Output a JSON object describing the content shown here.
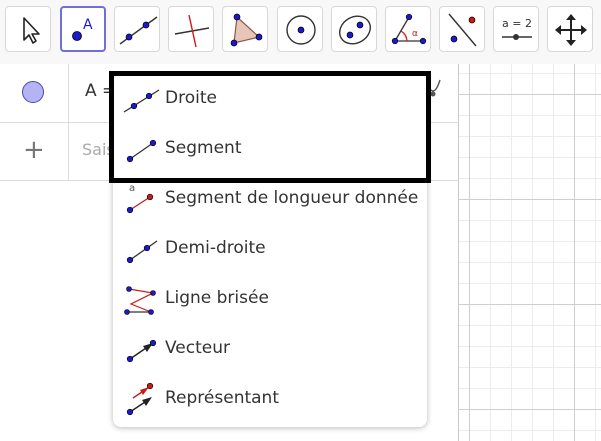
{
  "toolbar": {
    "tools": [
      {
        "name": "move-tool"
      },
      {
        "name": "point-tool",
        "label": "A"
      },
      {
        "name": "line-tool"
      },
      {
        "name": "perpendicular-line-tool"
      },
      {
        "name": "polygon-tool"
      },
      {
        "name": "circle-center-point-tool"
      },
      {
        "name": "ellipse-tool"
      },
      {
        "name": "angle-tool",
        "label": "α"
      },
      {
        "name": "reflect-tool"
      },
      {
        "name": "slider-tool",
        "label": "a = 2"
      },
      {
        "name": "move-graphics-view-tool"
      }
    ],
    "active_tool": "point-tool"
  },
  "algebra": {
    "row1_expression": "A = (",
    "input_placeholder": "Sais"
  },
  "menu": {
    "items": [
      {
        "label": "Droite",
        "icon": "line-icon"
      },
      {
        "label": "Segment",
        "icon": "segment-icon"
      },
      {
        "label": "Segment de longueur donnée",
        "icon": "segment-fixed-length-icon",
        "icon_text": "a"
      },
      {
        "label": "Demi-droite",
        "icon": "ray-icon"
      },
      {
        "label": "Ligne brisée",
        "icon": "polyline-icon"
      },
      {
        "label": "Vecteur",
        "icon": "vector-icon"
      },
      {
        "label": "Représentant",
        "icon": "vector-from-point-icon"
      }
    ],
    "highlighted_items": [
      "Droite",
      "Segment"
    ]
  },
  "colors": {
    "point_blue": "#1a1acc",
    "point_red": "#cc1a1a",
    "active_border": "#6f6fd6",
    "marble_fill": "#b4b4f5"
  }
}
